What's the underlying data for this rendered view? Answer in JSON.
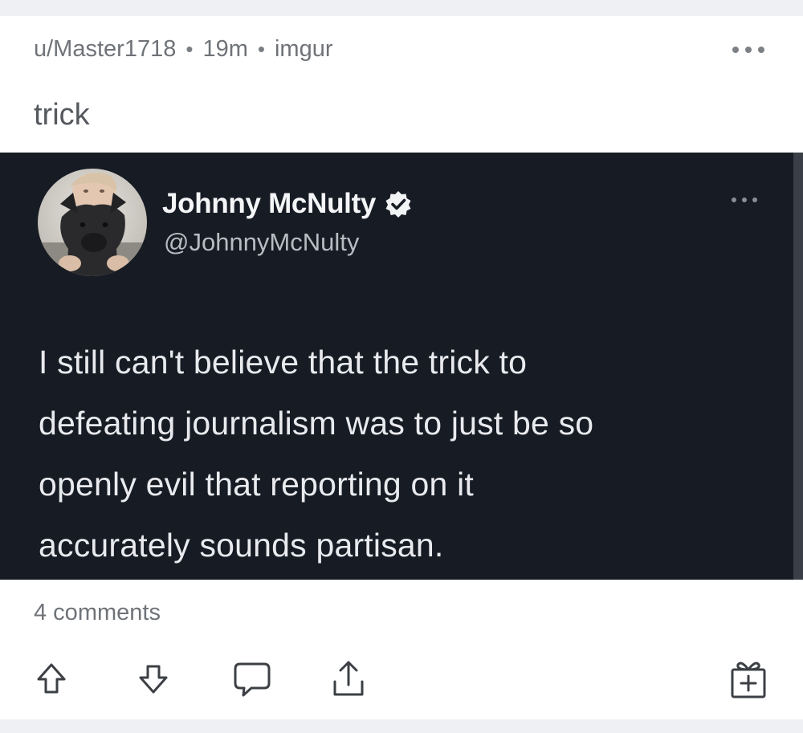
{
  "post": {
    "author": "u/Master1718",
    "separator": "•",
    "age": "19m",
    "source": "imgur",
    "title": "trick",
    "comments_label": "4 comments"
  },
  "tweet": {
    "display_name": "Johnny McNulty",
    "handle": "@JohnnyMcNulty",
    "verified": true,
    "text_lines": [
      "I still can't believe that the trick to",
      "defeating journalism was to just be so",
      "openly evil that reporting on it",
      "accurately sounds partisan."
    ]
  },
  "icons": {
    "more": "more-horizontal-icon",
    "upvote": "upvote-arrow-icon",
    "downvote": "downvote-arrow-icon",
    "comment": "comment-bubble-icon",
    "share": "share-icon",
    "award": "award-gift-icon",
    "verified": "verified-badge-icon"
  },
  "colors": {
    "page_bg": "#eef0f3",
    "card_bg": "#ffffff",
    "tweet_bg": "#171b24",
    "meta_text": "#6f7378",
    "tweet_text": "#e8eaee"
  }
}
